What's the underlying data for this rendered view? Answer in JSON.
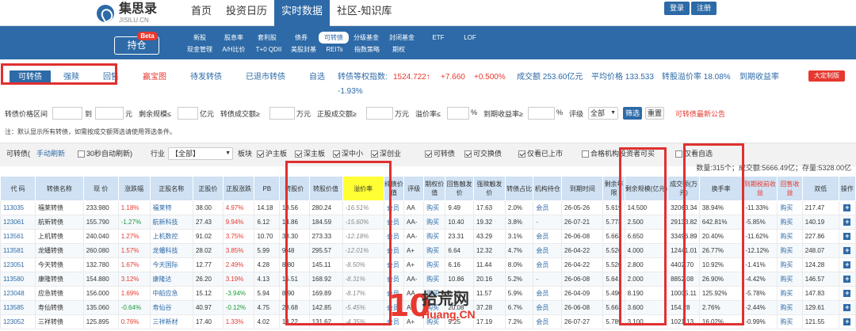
{
  "brand": {
    "name": "集思录",
    "sub": "JISILU.CN"
  },
  "topnav": [
    "首页",
    "投资日历",
    "实时数据",
    "社区-知识库"
  ],
  "auth": {
    "login": "登录",
    "register": "注册"
  },
  "chicang": {
    "label": "持仓",
    "badge": "Beta"
  },
  "sublinks": {
    "row1": [
      "新股",
      "股息率",
      "套利股",
      "债券",
      "可转债",
      "分级基金",
      "封闭基金",
      "ETF",
      "LOF"
    ],
    "row2": [
      "现金管理",
      "A/H比价",
      "T+0 QDII",
      "美股封基",
      "REITs",
      "指数策略",
      "期权"
    ]
  },
  "tabs": {
    "t1": "可转债",
    "t2": "强赎",
    "t3": "回售",
    "t4": "赢宝图",
    "t5": "待发转债",
    "t6": "已退市转债",
    "t7": "自选"
  },
  "index": {
    "label": "转债等权指数:",
    "value": "1524.722↑",
    "change": "+7.660",
    "pct": "+0.500%",
    "turnover": "成交额 253.60亿元",
    "avg_price": "平均价格 133.533",
    "premium": "转股溢价率 18.08%",
    "ytm": "到期收益率",
    "second": "-1.93%"
  },
  "custom_btn": "大定制版",
  "filters": {
    "price_range": "转债价格区间",
    "to": "到",
    "yuan": "元",
    "remain": "剩余规模≤",
    "yi": "亿元",
    "turnover": "转债成交额≥",
    "wan": "万元",
    "stock_turnover": "正股成交额≥",
    "premium": "溢价率≤",
    "pct": "%",
    "ytm": "到期收益率≥",
    "rating": "评级",
    "rating_value": "全部",
    "filter_btn": "筛选",
    "reset_btn": "重置",
    "notice": "可转债最新公告"
  },
  "note": "注：默认显示所有转债，如需按成交额筛选请使用筛选条件。",
  "controls": {
    "title": "可转债(",
    "manual": "手动刷新",
    ")": ")",
    "auto": "30秒自动刷新)",
    "industry": "行业",
    "industry_val": "【全部】",
    "plate": "板块",
    "sh": "沪主板",
    "sz": "深主板",
    "zx": "深中小",
    "cy": "深创业",
    "kzz": "可转债",
    "kjh": "可交换债",
    "listed": "仅看已上市",
    "qualified": "合格机构投资者可买",
    "mine": "仅看自选"
  },
  "summary": "数量:315个；成交额:5666.49亿；存量:5328.00亿",
  "table": {
    "headers": [
      "代 码",
      "转债名称",
      "现 价",
      "涨跌幅",
      "正股名称",
      "正股价",
      "正股涨跌",
      "PB",
      "转股价",
      "转股价值",
      "溢价率",
      "纯债价值",
      "评级",
      "期权价值",
      "回售触发价",
      "强赎触发价",
      "转债占比",
      "机构持仓",
      "到期时间",
      "剩余年限",
      "剩余规模(亿元)",
      "成交额(万元)",
      "换手率",
      "到期税前收益",
      "回售收益",
      "双低",
      "操作"
    ],
    "rows": [
      [
        "113035",
        "福莱转债",
        "233.980",
        "1.18%",
        "福莱特",
        "38.00",
        "4.97%",
        "14.18",
        "13.56",
        "280.24",
        "-16.51%",
        "会员",
        "AA",
        "购买",
        "9.49",
        "17.63",
        "2.0%",
        "会员",
        "26-05-26",
        "5.619",
        "14.500",
        "32063.34",
        "38.94%",
        "-11.33%",
        "购买",
        "217.47"
      ],
      [
        "123061",
        "航新转债",
        "155.790",
        "-1.27%",
        "航新科技",
        "27.43",
        "9.94%",
        "6.12",
        "14.86",
        "184.59",
        "-15.60%",
        "会员",
        "AA-",
        "购买",
        "10.40",
        "19.32",
        "3.8%",
        "-",
        "26-07-21",
        "5.773",
        "2.500",
        "29133.82",
        "642.81%",
        "-5.85%",
        "购买",
        "140.19"
      ],
      [
        "113561",
        "上机转债",
        "240.040",
        "1.27%",
        "上机数控",
        "91.02",
        "3.75%",
        "10.70",
        "33.30",
        "273.33",
        "-12.18%",
        "会员",
        "AA-",
        "购买",
        "23.31",
        "43.29",
        "3.1%",
        "会员",
        "26-06-08",
        "5.663",
        "6.650",
        "33496.89",
        "20.40%",
        "-11.62%",
        "购买",
        "227.86"
      ],
      [
        "113581",
        "龙蟠转债",
        "260.080",
        "1.57%",
        "龙蟠科技",
        "28.02",
        "3.85%",
        "5.99",
        "9.48",
        "295.57",
        "-12.01%",
        "会员",
        "A+",
        "购买",
        "6.64",
        "12.32",
        "4.7%",
        "会员",
        "26-04-22",
        "5.526",
        "4.000",
        "12441.01",
        "26.77%",
        "-12.12%",
        "购买",
        "248.07"
      ],
      [
        "123051",
        "今天转债",
        "132.780",
        "1.67%",
        "今天国际",
        "12.77",
        "2.49%",
        "4.28",
        "8.80",
        "145.11",
        "-8.50%",
        "会员",
        "A+",
        "购买",
        "6.16",
        "11.44",
        "8.0%",
        "会员",
        "26-04-22",
        "5.526",
        "2.800",
        "4402.70",
        "10.92%",
        "-1.41%",
        "购买",
        "124.28"
      ],
      [
        "113580",
        "康隆转债",
        "154.880",
        "3.12%",
        "康隆达",
        "26.20",
        "3.19%",
        "4.13",
        "15.51",
        "168.92",
        "-8.31%",
        "会员",
        "AA-",
        "购买",
        "10.86",
        "20.16",
        "5.2%",
        "-",
        "26-06-08",
        "5.641",
        "2.000",
        "8852.08",
        "26.90%",
        "-4.42%",
        "购买",
        "146.57"
      ],
      [
        "123048",
        "应急转债",
        "156.000",
        "1.69%",
        "中船应急",
        "15.12",
        "-3.94%",
        "5.94",
        "8.90",
        "169.89",
        "-8.17%",
        "会员",
        "AA",
        "购买",
        "6.23",
        "11.57",
        "5.9%",
        "会员",
        "26-04-09",
        "5.490",
        "8.190",
        "10005.11",
        "125.92%",
        "-5.78%",
        "购买",
        "147.83"
      ],
      [
        "113585",
        "寿仙转债",
        "135.060",
        "-0.64%",
        "寿仙谷",
        "40.97",
        "-0.12%",
        "4.75",
        "28.68",
        "142.85",
        "-5.45%",
        "会员",
        "A+",
        "购买",
        "20.08",
        "37.28",
        "6.7%",
        "会员",
        "26-06-08",
        "5.663",
        "3.600",
        "154.28",
        "2.76%",
        "-2.44%",
        "购买",
        "129.61"
      ],
      [
        "123052",
        "三祥转债",
        "125.895",
        "0.76%",
        "三祥新材",
        "17.40",
        "1.33%",
        "4.02",
        "13.22",
        "131.62",
        "-4.35%",
        "会员",
        "A+",
        "购买",
        "9.25",
        "17.19",
        "7.2%",
        "会员",
        "26-07-27",
        "5.789",
        "3.100",
        "1021.13",
        "16.02%",
        "-0.99%",
        "购买",
        "121.55"
      ]
    ]
  },
  "watermark": {
    "num": "10",
    "title": "拾荒网",
    "url": "Huang.CN"
  }
}
